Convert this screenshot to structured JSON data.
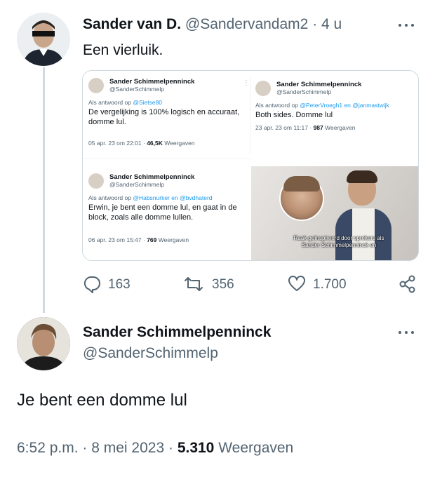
{
  "tweet1": {
    "name": "Sander van D.",
    "handle": "@Sandervandam2",
    "time": "4 u",
    "text": "Een vierluik.",
    "media": {
      "cards": [
        {
          "name": "Sander Schimmelpenninck",
          "handle": "@SanderSchimmelp",
          "reply_prefix": "Als antwoord op",
          "reply_to": "@Sietse80",
          "body": "De vergelijking is 100% logisch en accuraat, domme lul.",
          "date": "05 apr. 23 om 22:01 ·",
          "views": "46,5K",
          "views_label": "Weergaven"
        },
        {
          "name": "Sander Schimmelpenninck",
          "handle": "@SanderSchimmelp",
          "reply_prefix": "Als antwoord op",
          "reply_to": "@PeterVroegh1 en @janmastwijk",
          "body": "Both sides. Domme lul",
          "date": "23 apr. 23 om 11:17 ·",
          "views": "987",
          "views_label": "Weergaven"
        },
        {
          "name": "Sander Schimmelpenninck",
          "handle": "@SanderSchimmelp",
          "reply_prefix": "Als antwoord op",
          "reply_to": "@Habsnurker en @bvdhaterd",
          "body": "Erwin, je bent een domme lul, en gaat in de block, zoals alle domme lullen.",
          "date": "06 apr. 23 om 15:47 ·",
          "views": "769",
          "views_label": "Weergaven"
        }
      ],
      "video_caption": "Raak geïnspireerd door sprekers als Sander Schimmelpenninck en"
    },
    "actions": {
      "replies": "163",
      "retweets": "356",
      "likes": "1.700"
    }
  },
  "tweet2": {
    "name": "Sander Schimmelpenninck",
    "handle": "@SanderSchimmelp",
    "text": "Je bent een domme lul",
    "time": "6:52 p.m.",
    "date": "8 mei 2023",
    "views": "5.310",
    "views_label": "Weergaven"
  },
  "colors": {
    "text": "#0f1419",
    "secondary": "#536471",
    "link": "#1d9bf0",
    "border": "#cfd9de"
  },
  "icons": [
    "more-icon",
    "reply-icon",
    "retweet-icon",
    "like-icon",
    "share-icon"
  ]
}
